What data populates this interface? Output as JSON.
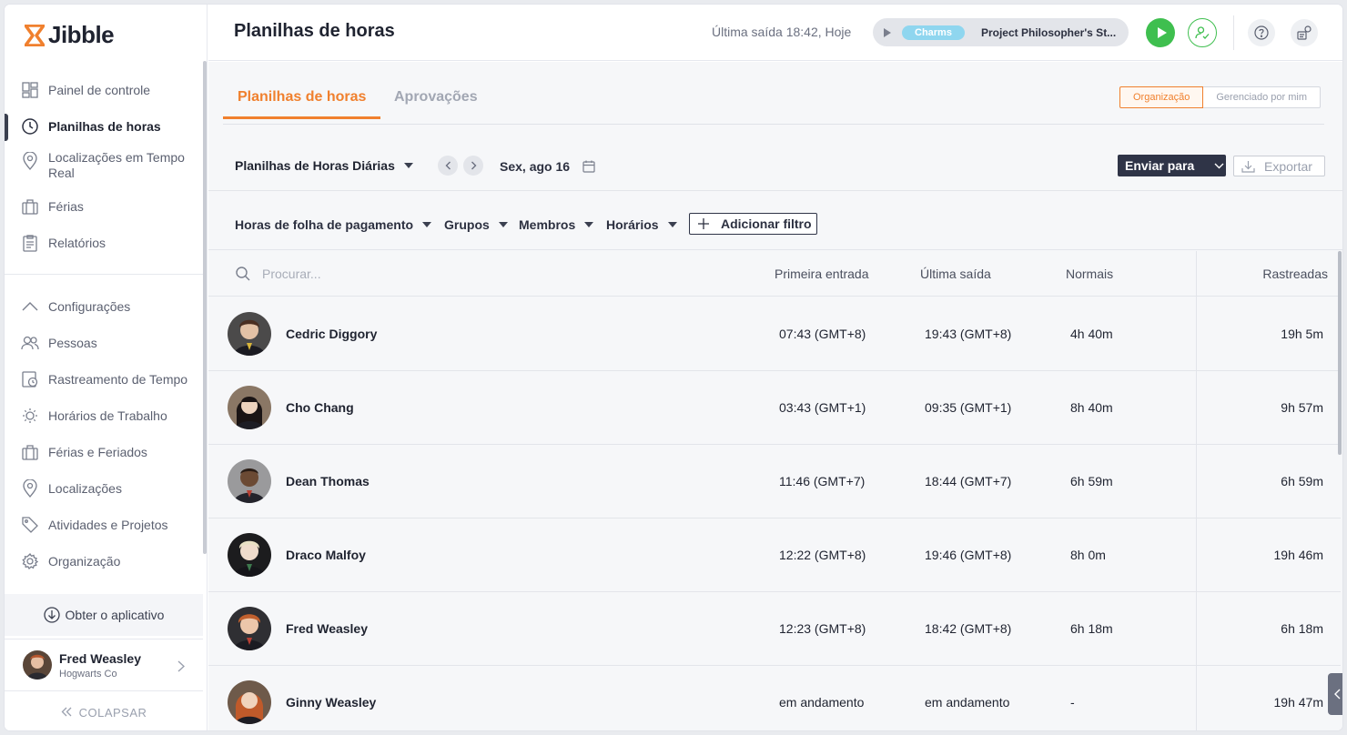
{
  "brand": {
    "name": "Jibble",
    "accent": "#f0802e"
  },
  "sidebar": {
    "items": [
      {
        "label": "Painel de controle",
        "icon": "dashboard-icon",
        "active": false
      },
      {
        "label": "Planilhas de horas",
        "icon": "clock-icon",
        "active": true
      },
      {
        "label": "Localizações em Tempo Real",
        "icon": "location-pin-icon",
        "active": false
      },
      {
        "label": "Férias",
        "icon": "suitcase-icon",
        "active": false
      },
      {
        "label": "Relatórios",
        "icon": "clipboard-icon",
        "active": false
      }
    ],
    "settings_items": [
      {
        "label": "Configurações",
        "icon": "chevron-up-icon"
      },
      {
        "label": "Pessoas",
        "icon": "people-icon"
      },
      {
        "label": "Rastreamento de Tempo",
        "icon": "time-tracking-icon"
      },
      {
        "label": "Horários de Trabalho",
        "icon": "work-schedule-icon"
      },
      {
        "label": "Férias e Feriados",
        "icon": "suitcase-icon"
      },
      {
        "label": "Localizações",
        "icon": "location-pin-icon"
      },
      {
        "label": "Atividades e Projetos",
        "icon": "tag-icon"
      },
      {
        "label": "Organização",
        "icon": "gear-icon"
      }
    ],
    "get_app": "Obter o aplicativo",
    "user": {
      "name": "Fred Weasley",
      "org": "Hogwarts Co"
    },
    "collapse": "COLAPSAR"
  },
  "header": {
    "title": "Planilhas de horas",
    "last_out": "Última saída 18:42, Hoje",
    "activity": "Charms",
    "project": "Project Philosopher's St..."
  },
  "tabs": [
    {
      "label": "Planilhas de horas",
      "active": true
    },
    {
      "label": "Aprovações",
      "active": false
    }
  ],
  "scope": {
    "org": "Organização",
    "managed": "Gerenciado por mim"
  },
  "toolbar": {
    "view": "Planilhas de Horas Diárias",
    "date": "Sex, ago 16",
    "send": "Enviar para",
    "export": "Exportar"
  },
  "filters": {
    "payroll": "Horas de folha de pagamento",
    "groups": "Grupos",
    "members": "Membros",
    "schedules": "Horários",
    "add": "Adicionar filtro"
  },
  "table": {
    "search_placeholder": "Procurar...",
    "columns": [
      "Primeira entrada",
      "Última saída",
      "Normais",
      "Rastreadas"
    ],
    "rows": [
      {
        "name": "Cedric Diggory",
        "first_in": "07:43 (GMT+8)",
        "last_out": "19:43 (GMT+8)",
        "regular": "4h 40m",
        "tracked": "19h 5m"
      },
      {
        "name": "Cho Chang",
        "first_in": "03:43 (GMT+1)",
        "last_out": "09:35 (GMT+1)",
        "regular": "8h 40m",
        "tracked": "9h 57m"
      },
      {
        "name": "Dean Thomas",
        "first_in": "11:46 (GMT+7)",
        "last_out": "18:44 (GMT+7)",
        "regular": "6h 59m",
        "tracked": "6h 59m"
      },
      {
        "name": "Draco Malfoy",
        "first_in": "12:22 (GMT+8)",
        "last_out": "19:46 (GMT+8)",
        "regular": "8h 0m",
        "tracked": "19h 46m"
      },
      {
        "name": "Fred Weasley",
        "first_in": "12:23 (GMT+8)",
        "last_out": "18:42 (GMT+8)",
        "regular": "6h 18m",
        "tracked": "6h 18m"
      },
      {
        "name": "Ginny Weasley",
        "first_in": "em andamento",
        "last_out": "em andamento",
        "regular": "-",
        "tracked": "19h 47m"
      }
    ]
  }
}
